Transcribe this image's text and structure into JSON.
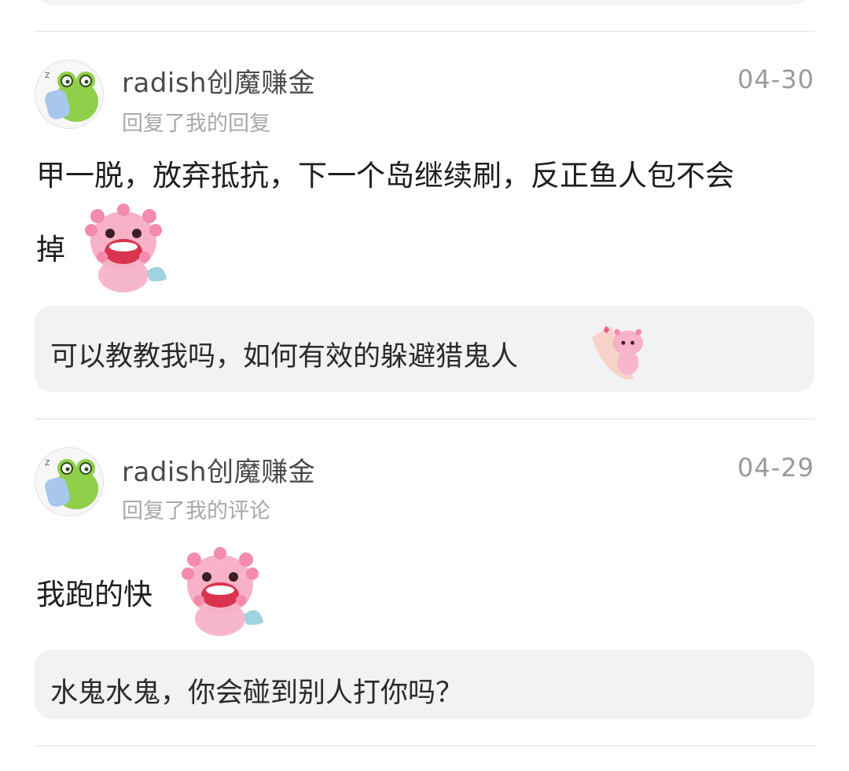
{
  "comments": [
    {
      "username": "radish创魔赚金",
      "action": "回复了我的回复",
      "date": "04-30",
      "body_line1": "甲一脱，放弃抵抗，下一个岛继续刷，反正鱼人包不会",
      "body_line2": "掉",
      "quote": "可以教教我吗，如何有效的躲避猎鬼人",
      "avatar_icon": "frog-with-pillow-icon",
      "sticker_icon": "pink-axolotl-laughing-sticker"
    },
    {
      "username": "radish创魔赚金",
      "action": "回复了我的评论",
      "date": "04-29",
      "body_line1": "我跑的快",
      "quote": "水鬼水鬼，你会碰到别人打你吗？",
      "avatar_icon": "frog-with-pillow-icon",
      "sticker_icon": "pink-axolotl-laughing-sticker"
    }
  ],
  "colors": {
    "background": "#ffffff",
    "quote_background": "#f2f2f4",
    "secondary_text": "#a8a8a8",
    "sticker_pink": "#f4a3bd"
  }
}
